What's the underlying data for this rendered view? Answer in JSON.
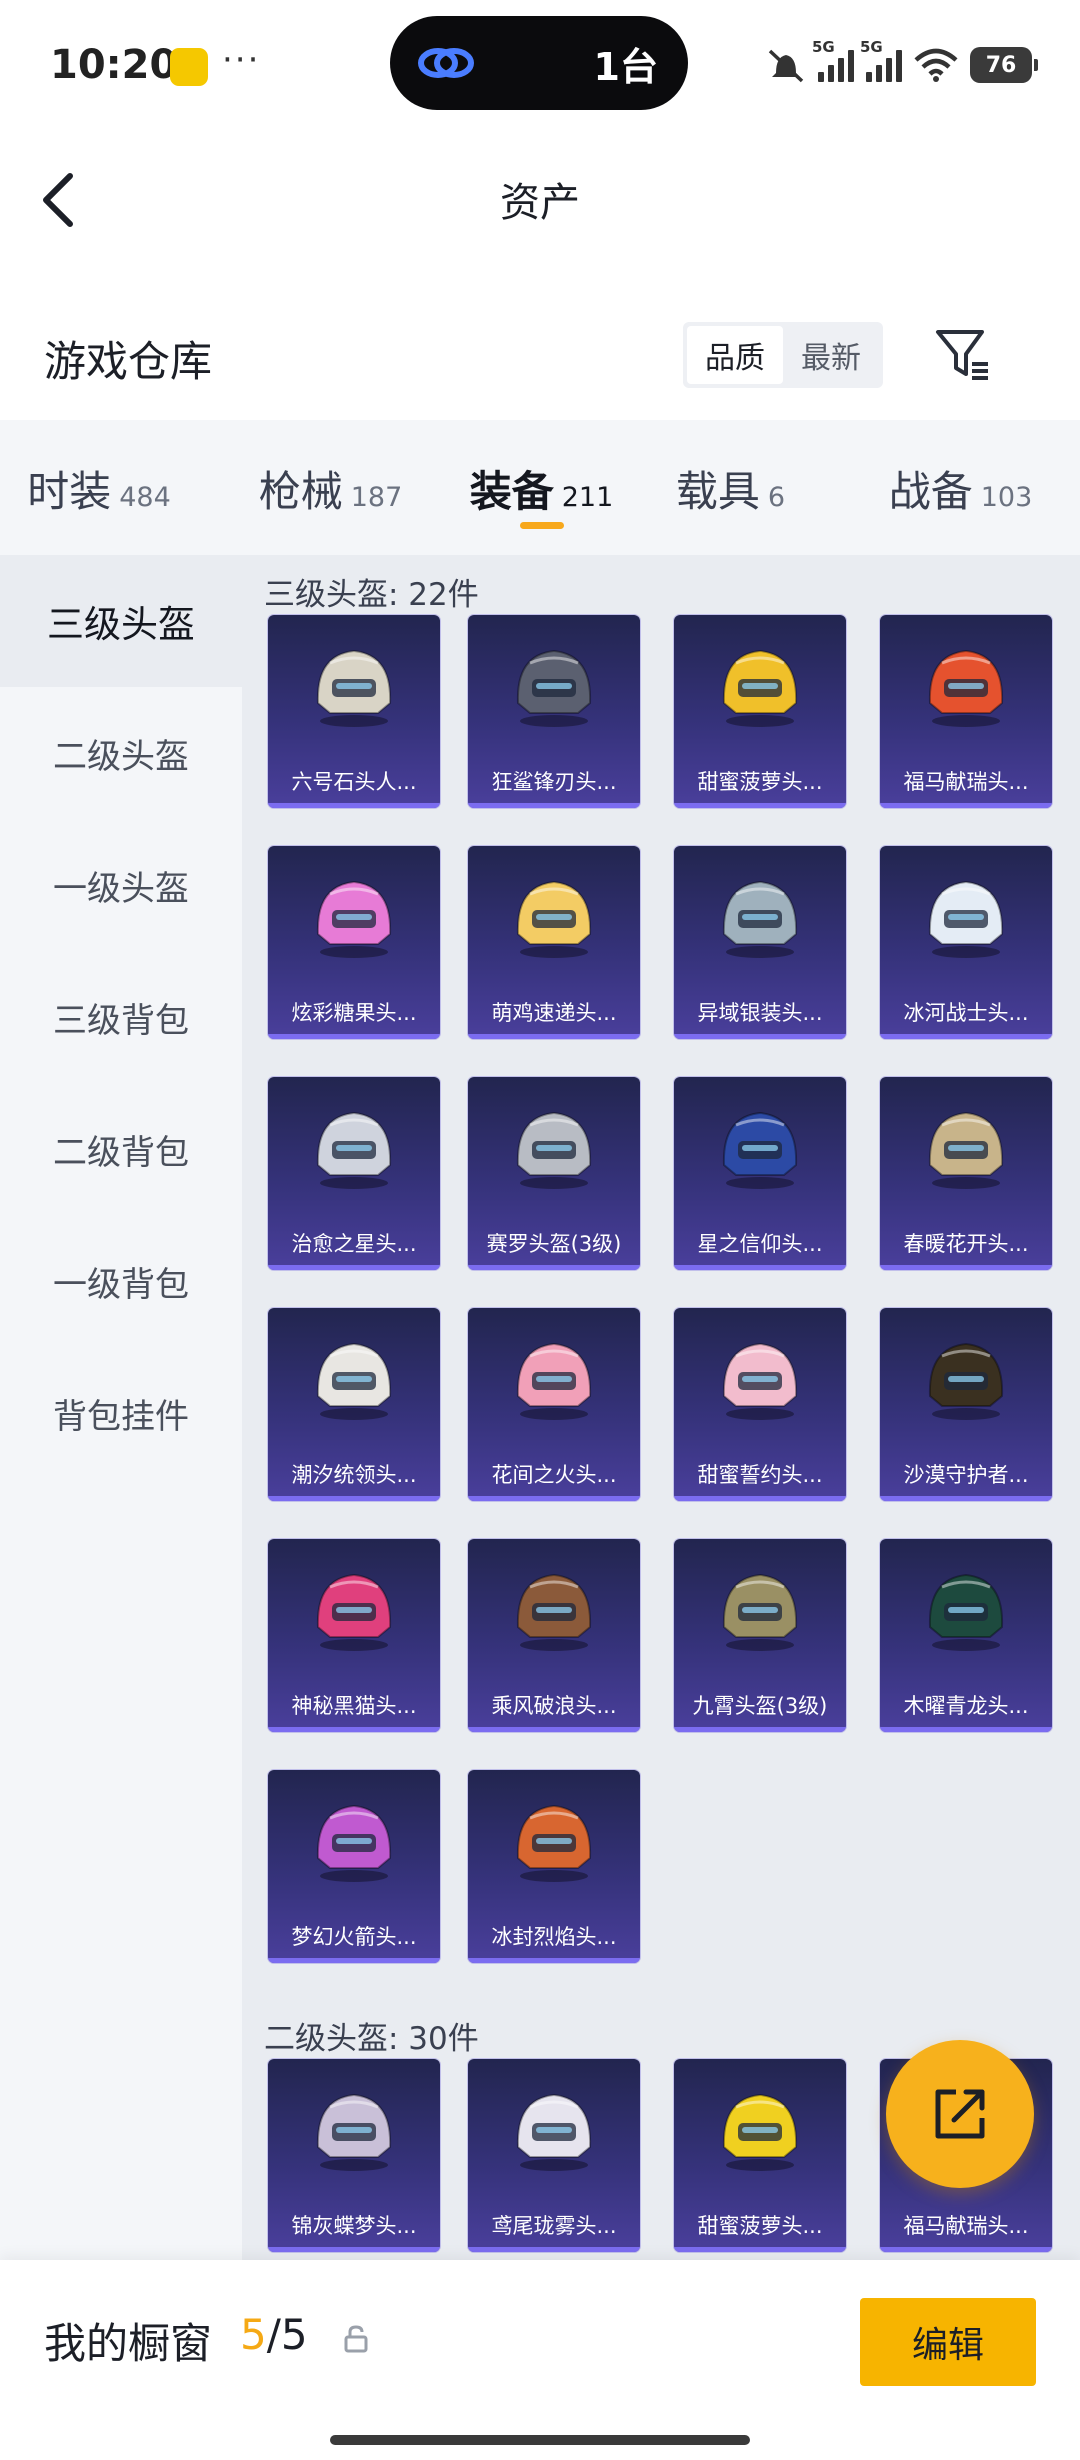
{
  "status_bar": {
    "time": "10:20",
    "more": "···",
    "island_text": "1台",
    "battery": "76",
    "network": "5G"
  },
  "nav": {
    "title": "资产"
  },
  "repo": {
    "title": "游戏仓库",
    "sort_quality": "品质",
    "sort_latest": "最新"
  },
  "tabs": [
    {
      "label": "时装",
      "count": "484"
    },
    {
      "label": "枪械",
      "count": "187"
    },
    {
      "label": "装备",
      "count": "211",
      "active": true
    },
    {
      "label": "载具",
      "count": "6"
    },
    {
      "label": "战备",
      "count": "103"
    }
  ],
  "sidebar": [
    {
      "label": "三级头盔",
      "active": true
    },
    {
      "label": "二级头盔"
    },
    {
      "label": "一级头盔"
    },
    {
      "label": "三级背包"
    },
    {
      "label": "二级背包"
    },
    {
      "label": "一级背包"
    },
    {
      "label": "背包挂件"
    }
  ],
  "sections": [
    {
      "title": "三级头盔: 22件",
      "items": [
        {
          "name": "六号石头人...",
          "color": "#d9d4c6"
        },
        {
          "name": "狂鲨锋刃头...",
          "color": "#5b6070"
        },
        {
          "name": "甜蜜菠萝头...",
          "color": "#f0c02a"
        },
        {
          "name": "福马献瑞头...",
          "color": "#e5522e"
        },
        {
          "name": "炫彩糖果头...",
          "color": "#e77bd6"
        },
        {
          "name": "萌鸡速递头...",
          "color": "#f3cc64"
        },
        {
          "name": "异域银装头...",
          "color": "#9fb1bd"
        },
        {
          "name": "冰河战士头...",
          "color": "#e4ecf5"
        },
        {
          "name": "治愈之星头...",
          "color": "#cfd3dd"
        },
        {
          "name": "赛罗头盔(3级)",
          "color": "#b8bcc4"
        },
        {
          "name": "星之信仰头...",
          "color": "#2c4aa5"
        },
        {
          "name": "春暖花开头...",
          "color": "#c8b48a"
        },
        {
          "name": "潮汐统领头...",
          "color": "#e8e6e2"
        },
        {
          "name": "花间之火头...",
          "color": "#f1a0b8"
        },
        {
          "name": "甜蜜誓约头...",
          "color": "#f2bccd"
        },
        {
          "name": "沙漠守护者...",
          "color": "#3a3020"
        },
        {
          "name": "神秘黑猫头...",
          "color": "#e0407d"
        },
        {
          "name": "乘风破浪头...",
          "color": "#8b5a3a"
        },
        {
          "name": "九霄头盔(3级)",
          "color": "#9a9064"
        },
        {
          "name": "木曜青龙头...",
          "color": "#1d4a3e"
        },
        {
          "name": "梦幻火箭头...",
          "color": "#c05ad0"
        },
        {
          "name": "冰封烈焰头...",
          "color": "#d86630"
        }
      ]
    },
    {
      "title": "二级头盔: 30件",
      "items": [
        {
          "name": "锦灰蝶梦头...",
          "color": "#c9c0d8"
        },
        {
          "name": "鸢尾珑雾头...",
          "color": "#e6e4ee"
        },
        {
          "name": "甜蜜菠萝头...",
          "color": "#f0d020"
        },
        {
          "name": "福马献瑞头...",
          "color": "#e5522e"
        }
      ]
    }
  ],
  "bottom": {
    "label": "我的橱窗",
    "current": "5",
    "separator": "/",
    "total": "5",
    "edit": "编辑"
  },
  "colors": {
    "accent": "#f7b400",
    "card_bg": "#35327a",
    "card_border": "#7b6cf0"
  }
}
